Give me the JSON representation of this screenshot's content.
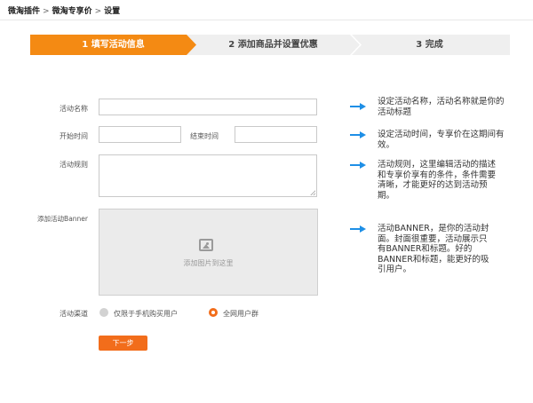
{
  "breadcrumb": {
    "items": [
      "微淘插件",
      "微淘专享价",
      "设置"
    ],
    "separator": ">"
  },
  "steps": [
    {
      "label": "1 填写活动信息",
      "active": true
    },
    {
      "label": "2 添加商品并设置优惠",
      "active": false
    },
    {
      "label": "3 完成",
      "active": false
    }
  ],
  "form": {
    "name_label": "活动名称",
    "name_value": "",
    "start_label": "开始时间",
    "start_value": "",
    "end_label": "结束时间",
    "end_value": "",
    "rules_label": "活动规则",
    "rules_value": "",
    "banner_label": "添加活动Banner",
    "banner_hint": "添加图片到这里",
    "channel_label": "活动渠道",
    "channel_options": [
      {
        "label": "仅限于手机购买用户",
        "selected": false
      },
      {
        "label": "全网用户群",
        "selected": true
      }
    ],
    "next_label": "下一步"
  },
  "help": {
    "name": "设定活动名称，活动名称就是你的活动标题",
    "time": "设定活动时间，专享价在这期间有效。",
    "rules": "活动规则，这里编辑活动的描述和专享价享有的条件，条件需要清晰，才能更好的达到活动预期。",
    "banner": "活动BANNER，是你的活动封面。封面很重要，活动展示只有BANNER和标题。好的BANNER和标题，能更好的吸引用户。"
  },
  "colors": {
    "accent": "#f48a13",
    "button": "#f26d1b",
    "arrow": "#1e8fe6",
    "step_inactive": "#efefef"
  }
}
